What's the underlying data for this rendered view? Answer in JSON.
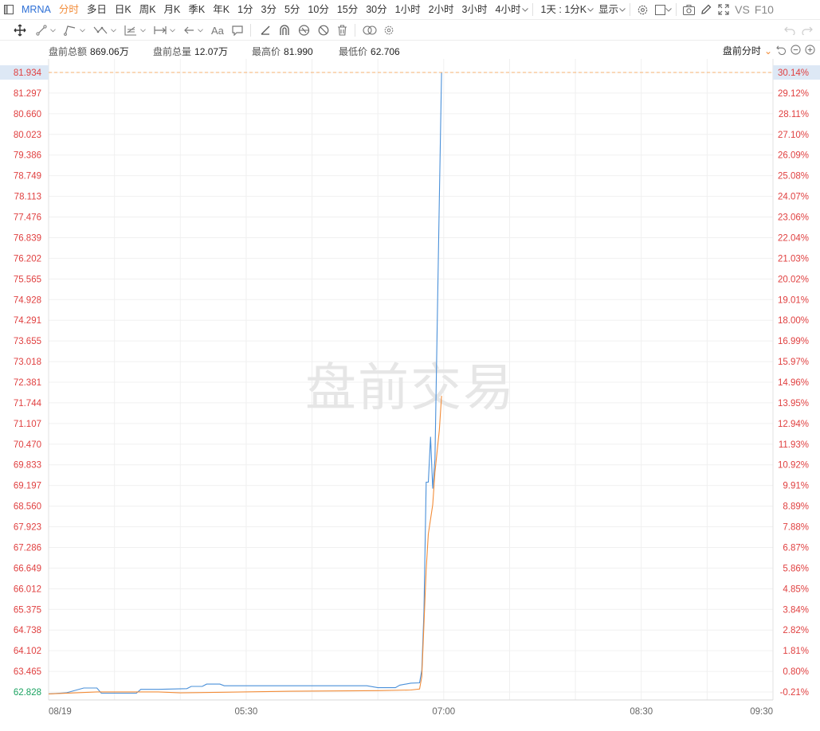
{
  "toolbar": {
    "symbol": "MRNA",
    "periods": [
      "分时",
      "多日",
      "日K",
      "周K",
      "月K",
      "季K",
      "年K",
      "1分",
      "3分",
      "5分",
      "10分",
      "15分",
      "30分",
      "1小时",
      "2小时",
      "3小时",
      "4小时"
    ],
    "active_period": "分时",
    "interval_select": "1天 : 1分K",
    "display_label": "显示",
    "vs_label": "VS",
    "f10_label": "F10"
  },
  "drawing_tools": {
    "text_tool_label": "Aa"
  },
  "info": {
    "amount_label": "盘前总额",
    "amount_value": "869.06万",
    "volume_label": "盘前总量",
    "volume_value": "12.07万",
    "high_label": "最高价",
    "high_value": "81.990",
    "low_label": "最低价",
    "low_value": "62.706",
    "mode_label": "盘前分时"
  },
  "watermark": "盘前交易",
  "colors": {
    "price_line": "#4a90d9",
    "avg_line": "#f28c38",
    "up": "#e04040",
    "down": "#1aa260",
    "grid": "#f0f0f0",
    "current_price_bg": "#dde8f5",
    "dash_line": "#f5b070"
  },
  "chart_data": {
    "type": "line",
    "y_left_ticks": [
      "81.934",
      "81.297",
      "80.660",
      "80.023",
      "79.386",
      "78.749",
      "78.113",
      "77.476",
      "76.839",
      "76.202",
      "75.565",
      "74.928",
      "74.291",
      "73.655",
      "73.018",
      "72.381",
      "71.744",
      "71.107",
      "70.470",
      "69.833",
      "69.197",
      "68.560",
      "67.923",
      "67.286",
      "66.649",
      "66.012",
      "65.375",
      "64.738",
      "64.102",
      "63.465",
      "62.828"
    ],
    "y_right_ticks": [
      "30.14%",
      "29.12%",
      "28.11%",
      "27.10%",
      "26.09%",
      "25.08%",
      "24.07%",
      "23.06%",
      "22.04%",
      "21.03%",
      "20.02%",
      "19.01%",
      "18.00%",
      "16.99%",
      "15.97%",
      "14.96%",
      "13.95%",
      "12.94%",
      "11.93%",
      "10.92%",
      "9.91%",
      "8.89%",
      "7.88%",
      "6.87%",
      "5.86%",
      "4.85%",
      "3.84%",
      "2.82%",
      "1.81%",
      "0.80%",
      "-0.21%"
    ],
    "ylim": [
      62.828,
      81.934
    ],
    "x_ticks": [
      "08/19",
      "05:30",
      "07:00",
      "08:30",
      "09:30"
    ],
    "x_range_minutes": [
      240,
      570
    ],
    "current_price": "81.934",
    "series": [
      {
        "points": [
          [
            240,
            62.77
          ],
          [
            248,
            62.8
          ],
          [
            256,
            62.95
          ],
          [
            262,
            62.95
          ],
          [
            264,
            62.79
          ],
          [
            280,
            62.79
          ],
          [
            282,
            62.91
          ],
          [
            290,
            62.91
          ],
          [
            303,
            62.93
          ],
          [
            305,
            63.0
          ],
          [
            310,
            63.0
          ],
          [
            312,
            63.07
          ],
          [
            318,
            63.07
          ],
          [
            320,
            63.02
          ],
          [
            350,
            63.02
          ],
          [
            360,
            63.02
          ],
          [
            385,
            63.02
          ],
          [
            390,
            62.96
          ],
          [
            398,
            62.96
          ],
          [
            400,
            63.04
          ],
          [
            405,
            63.1
          ],
          [
            409,
            63.11
          ],
          [
            410,
            63.5
          ],
          [
            411,
            65.3
          ],
          [
            412,
            69.3
          ],
          [
            413,
            69.3
          ],
          [
            414,
            70.7
          ],
          [
            415,
            69.1
          ],
          [
            416,
            70.0
          ],
          [
            418,
            78.0
          ],
          [
            419,
            81.93
          ]
        ]
      },
      {
        "points": [
          [
            240,
            62.77
          ],
          [
            262,
            62.83
          ],
          [
            290,
            62.83
          ],
          [
            300,
            62.8
          ],
          [
            320,
            62.82
          ],
          [
            350,
            62.85
          ],
          [
            390,
            62.87
          ],
          [
            405,
            62.89
          ],
          [
            409,
            62.92
          ],
          [
            410,
            63.3
          ],
          [
            412,
            66.6
          ],
          [
            413,
            67.7
          ],
          [
            415,
            68.6
          ],
          [
            416,
            69.6
          ],
          [
            418,
            70.9
          ],
          [
            419,
            71.96
          ]
        ]
      }
    ]
  }
}
